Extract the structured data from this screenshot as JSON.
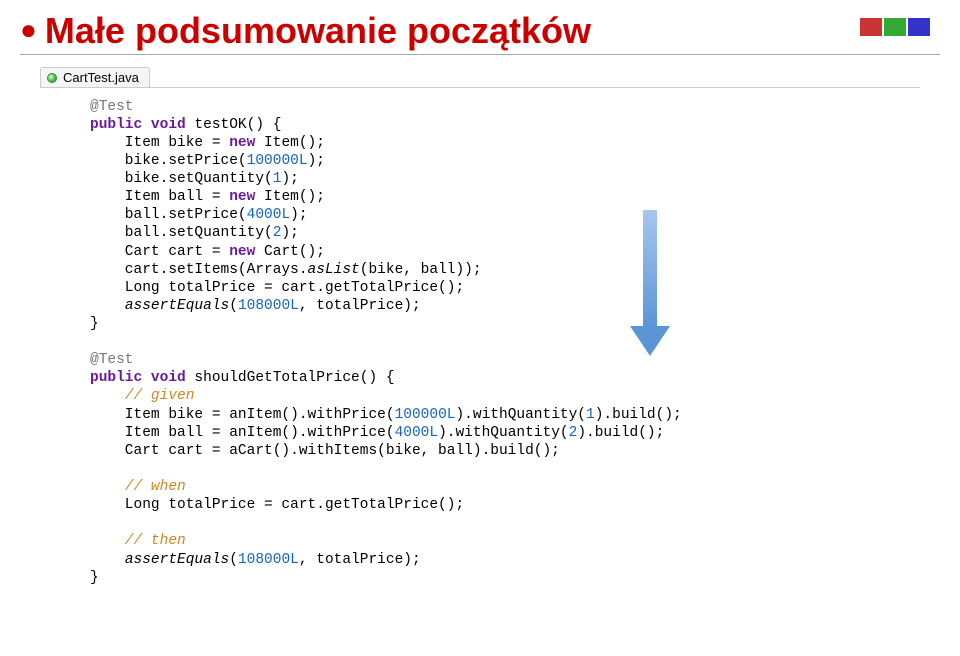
{
  "title": "Małe podsumowanie początków",
  "tab": {
    "label": "CartTest.java"
  },
  "code1": {
    "l1": "@Test",
    "l2a": "public void",
    "l2b": " testOK() {",
    "l3": "    Item bike = ",
    "l3b": "new",
    "l3c": " Item();",
    "l4": "    bike.setPrice(",
    "l4n": "100000L",
    "l4b": ");",
    "l5": "    bike.setQuantity(",
    "l5n": "1",
    "l5b": ");",
    "l6": "    Item ball = ",
    "l6b": "new",
    "l6c": " Item();",
    "l7": "    ball.setPrice(",
    "l7n": "4000L",
    "l7b": ");",
    "l8": "    ball.setQuantity(",
    "l8n": "2",
    "l8b": ");",
    "l9": "    Cart cart = ",
    "l9b": "new",
    "l9c": " Cart();",
    "l10": "    cart.setItems(Arrays.",
    "l10b": "asList",
    "l10c": "(bike, ball));",
    "l11": "    Long totalPrice = cart.getTotalPrice();",
    "l12a": "    ",
    "l12b": "assertEquals",
    "l12c": "(",
    "l12n": "108000L",
    "l12d": ", totalPrice);",
    "l13": "}"
  },
  "code2": {
    "l1": "@Test",
    "l2a": "public void",
    "l2b": " shouldGetTotalPrice() {",
    "c1": "    // given",
    "l3": "    Item bike = anItem().withPrice(",
    "l3n": "100000L",
    "l3b": ").withQuantity(",
    "l3n2": "1",
    "l3c": ").build();",
    "l4": "    Item ball = anItem().withPrice(",
    "l4n": "4000L",
    "l4b": ").withQuantity(",
    "l4n2": "2",
    "l4c": ").build();",
    "l5": "    Cart cart = aCart().withItems(bike, ball).build();",
    "c2": "    // when",
    "l6": "    Long totalPrice = cart.getTotalPrice();",
    "c3": "    // then",
    "l7a": "    ",
    "l7b": "assertEquals",
    "l7c": "(",
    "l7n": "108000L",
    "l7d": ", totalPrice);",
    "l8": "}"
  }
}
